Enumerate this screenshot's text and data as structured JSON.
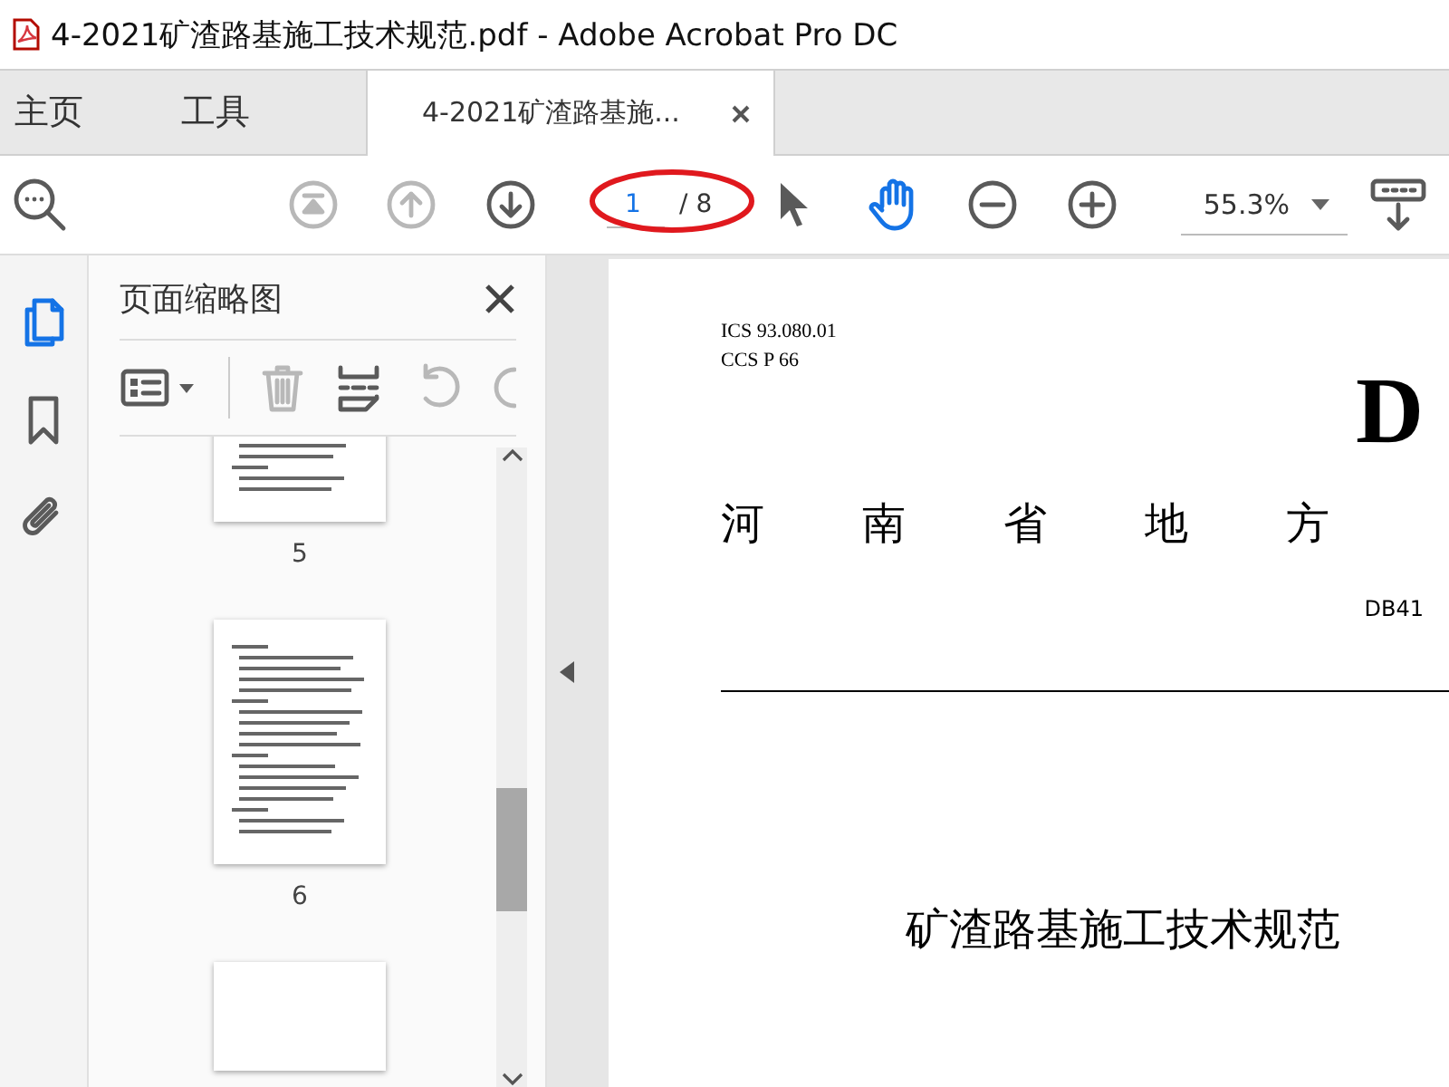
{
  "window": {
    "title": "4-2021矿渣路基施工技术规范.pdf - Adobe Acrobat Pro DC"
  },
  "tabs": [
    {
      "label": "主页",
      "selected": false,
      "kind": "nav"
    },
    {
      "label": "工具",
      "selected": false,
      "kind": "nav"
    },
    {
      "label": "4-2021矿渣路基施...",
      "selected": true,
      "kind": "document"
    }
  ],
  "toolbar": {
    "buttons": [
      {
        "kind": "search",
        "disabled": false
      },
      {
        "kind": "first",
        "disabled": true
      },
      {
        "kind": "prev",
        "disabled": true
      },
      {
        "kind": "next",
        "disabled": false
      }
    ],
    "page": {
      "current": "1",
      "total": "/ 8",
      "highlighted": true
    },
    "tools": [
      {
        "kind": "select",
        "selected": false
      },
      {
        "kind": "hand",
        "selected": true
      },
      {
        "kind": "zoom-out",
        "selected": false
      },
      {
        "kind": "zoom-in",
        "selected": false
      }
    ],
    "zoom": "55.3%"
  },
  "rail": [
    {
      "kind": "pages",
      "selected": true
    },
    {
      "kind": "bookmarks",
      "selected": false
    },
    {
      "kind": "attachments",
      "selected": false
    }
  ],
  "thumbnail_panel": {
    "title": "页面缩略图",
    "tools": [
      {
        "kind": "options",
        "disabled": false
      },
      {
        "kind": "delete",
        "disabled": true
      },
      {
        "kind": "insert",
        "disabled": false
      },
      {
        "kind": "rotate-ccw",
        "disabled": true
      },
      {
        "kind": "rotate-cw",
        "disabled": true
      }
    ],
    "thumbnails": [
      {
        "label": "5"
      },
      {
        "label": "6"
      }
    ],
    "more_below": true
  },
  "document": {
    "ics": "ICS 93.080.01",
    "ccs": "CCS P 66",
    "badge": "D",
    "heading_chars": [
      "河",
      "南",
      "省",
      "地",
      "方"
    ],
    "code": "DB41",
    "title": "矿渣路基施工技术规范"
  }
}
